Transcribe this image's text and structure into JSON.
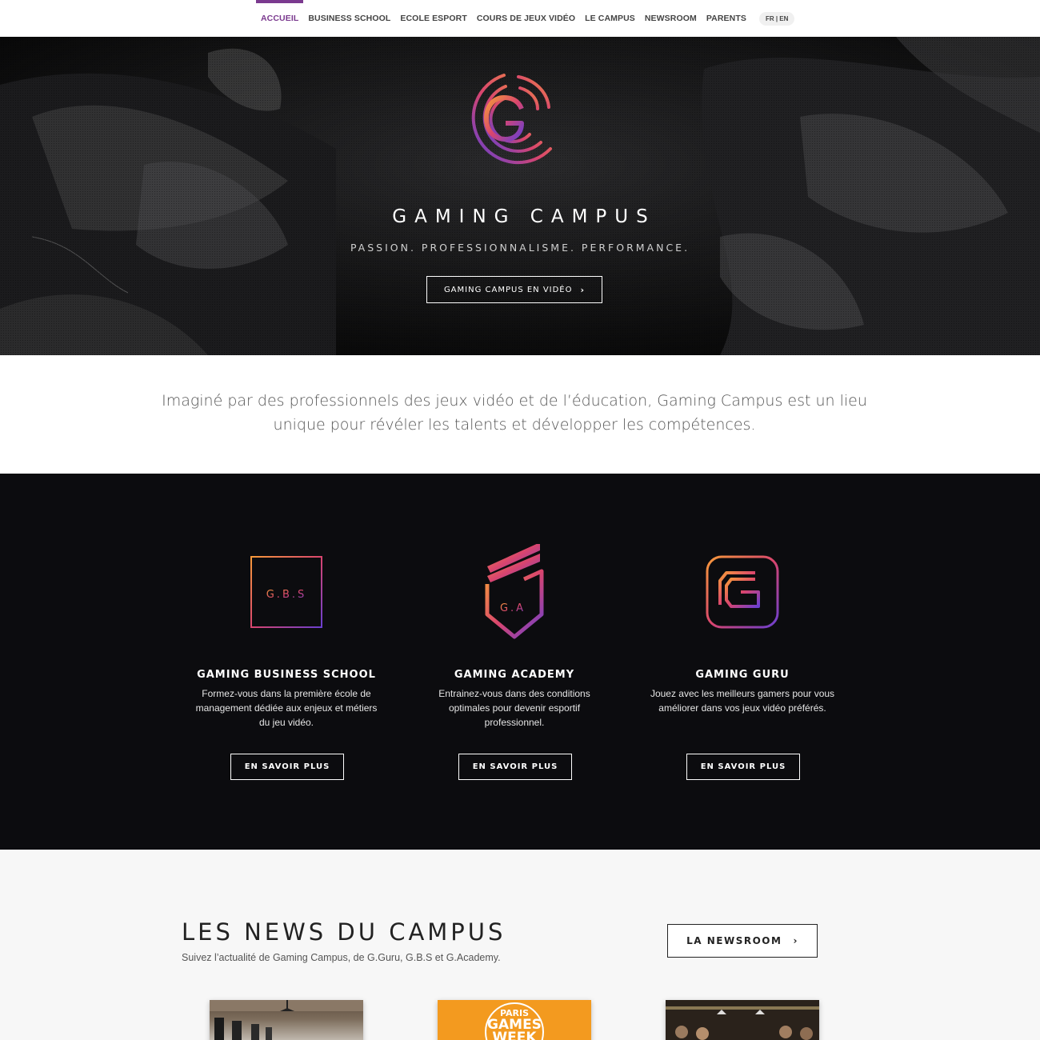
{
  "nav": {
    "items": [
      {
        "label": "ACCUEIL",
        "active": true
      },
      {
        "label": "BUSINESS SCHOOL"
      },
      {
        "label": "ECOLE ESPORT"
      },
      {
        "label": "COURS DE JEUX VIDÉO"
      },
      {
        "label": "LE CAMPUS"
      },
      {
        "label": "NEWSROOM"
      },
      {
        "label": "PARENTS"
      }
    ],
    "lang": "FR | EN"
  },
  "hero": {
    "title": "GAMING CAMPUS",
    "tagline": "PASSION. PROFESSIONNALISME. PERFORMANCE.",
    "button": "GAMING CAMPUS EN VIDÉO",
    "chevron": "›"
  },
  "intro": {
    "text": "Imaginé par des professionnels des jeux vidéo et de l’éducation, Gaming Campus est un lieu unique pour révéler les talents et développer les compétences."
  },
  "schools": [
    {
      "icon_text": "G.B.S",
      "name": "GAMING BUSINESS SCHOOL",
      "description": "Formez-vous dans la première école de management dédiée aux enjeux et métiers du jeu vidéo.",
      "button": "EN SAVOIR PLUS"
    },
    {
      "icon_text": "G.A",
      "name": "GAMING ACADEMY",
      "description": "Entrainez-vous dans des conditions optimales pour devenir esportif professionnel.",
      "button": "EN SAVOIR PLUS"
    },
    {
      "icon_text": "G",
      "name": "GAMING GURU",
      "description": "Jouez avec les meilleurs gamers pour vous améliorer dans vos jeux vidéo préférés.",
      "button": "EN SAVOIR PLUS"
    }
  ],
  "news": {
    "title": "LES NEWS DU CAMPUS",
    "subtitle": "Suivez l’actualité de Gaming Campus, de G.Guru, G.B.S et G.Academy.",
    "button": "LA NEWSROOM",
    "chevron": "›",
    "card2_logo": [
      "PARIS",
      "GAMES",
      "WEEK"
    ]
  },
  "colors": {
    "accent": "#7b3a8f",
    "gradient_start": "#f79a3a",
    "gradient_mid": "#d9456e",
    "gradient_end": "#6a3fd0",
    "dark_bg": "#0c0c0f"
  }
}
